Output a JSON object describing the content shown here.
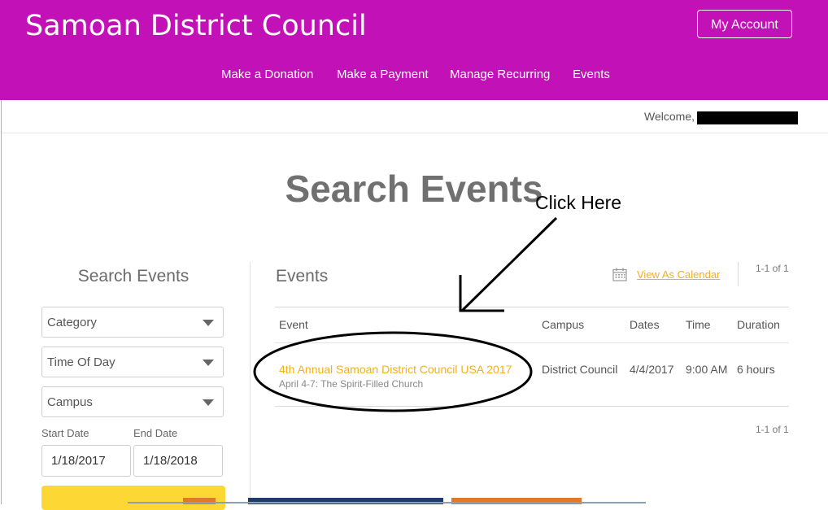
{
  "header": {
    "brand": "Samoan District Council",
    "account_button": "My Account",
    "nav": [
      "Make a Donation",
      "Make a Payment",
      "Manage Recurring",
      "Events"
    ],
    "color": "#c311b8"
  },
  "welcome": "Welcome,",
  "page_title": "Search Events",
  "annotation": "Click Here",
  "sidebar": {
    "title": "Search Events",
    "selects": [
      "Category",
      "Time Of Day",
      "Campus"
    ],
    "start_label": "Start Date",
    "end_label": "End Date",
    "start_value": "1/18/2017",
    "end_value": "1/18/2018",
    "button_color": "#fdd835"
  },
  "events": {
    "title": "Events",
    "view_calendar": "View As Calendar",
    "count": "1-1 of 1",
    "columns": [
      "Event",
      "Campus",
      "Dates",
      "Time",
      "Duration"
    ],
    "rows": [
      {
        "name": "4th Annual Samoan District Council USA 2017",
        "subtitle": "April 4-7: The Spirit-Filled Church",
        "campus": "District Council",
        "date": "4/4/2017",
        "time": "9:00 AM",
        "duration": "6 hours"
      }
    ],
    "accent": "#f1b11a"
  },
  "icons": [
    "calendar-icon",
    "chevron-down-icon"
  ]
}
